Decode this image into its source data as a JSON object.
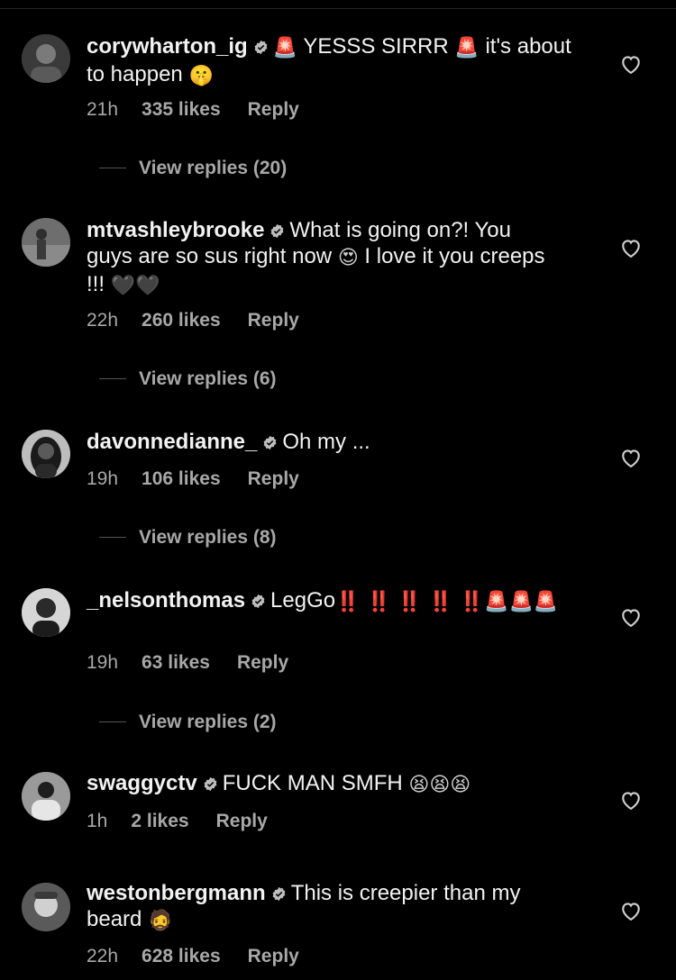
{
  "colors": {
    "background": "#000000",
    "text": "#f2f2f2",
    "muted": "#a8a8a8"
  },
  "comments": [
    {
      "username": "corywharton_ig",
      "text_segments": [
        "🚨",
        " YESSS SIRRR ",
        "🚨",
        " it's about to happen ",
        "🤫"
      ],
      "time": "21h",
      "likes": "335 likes",
      "reply": "Reply",
      "view_replies": "View replies (20)"
    },
    {
      "username": "mtvashleybrooke",
      "text_segments": [
        "What is going on?! You guys are so sus right now ",
        "😍",
        " I love it you creeps !!! ",
        "🖤",
        "🖤"
      ],
      "time": "22h",
      "likes": "260 likes",
      "reply": "Reply",
      "view_replies": "View replies (6)"
    },
    {
      "username": "davonnedianne_",
      "text_segments": [
        "Oh my ..."
      ],
      "time": "19h",
      "likes": "106 likes",
      "reply": "Reply",
      "view_replies": "View replies (8)"
    },
    {
      "username": "_nelsonthomas",
      "text_segments": [
        "LegGo",
        "‼️ ‼️ ‼️ ‼️ ‼️ ",
        "🚨",
        "🚨",
        "🚨"
      ],
      "time": "19h",
      "likes": "63 likes",
      "reply": "Reply",
      "view_replies": "View replies (2)"
    },
    {
      "username": "swaggyctv",
      "text_segments": [
        "FUCK MAN SMFH ",
        "😫",
        "😫",
        "😫"
      ],
      "time": "1h",
      "likes": "2 likes",
      "reply": "Reply"
    },
    {
      "username": "westonbergmann",
      "text_segments": [
        "This is creepier than my beard ",
        "🧔"
      ],
      "time": "22h",
      "likes": "628 likes",
      "reply": "Reply"
    }
  ]
}
